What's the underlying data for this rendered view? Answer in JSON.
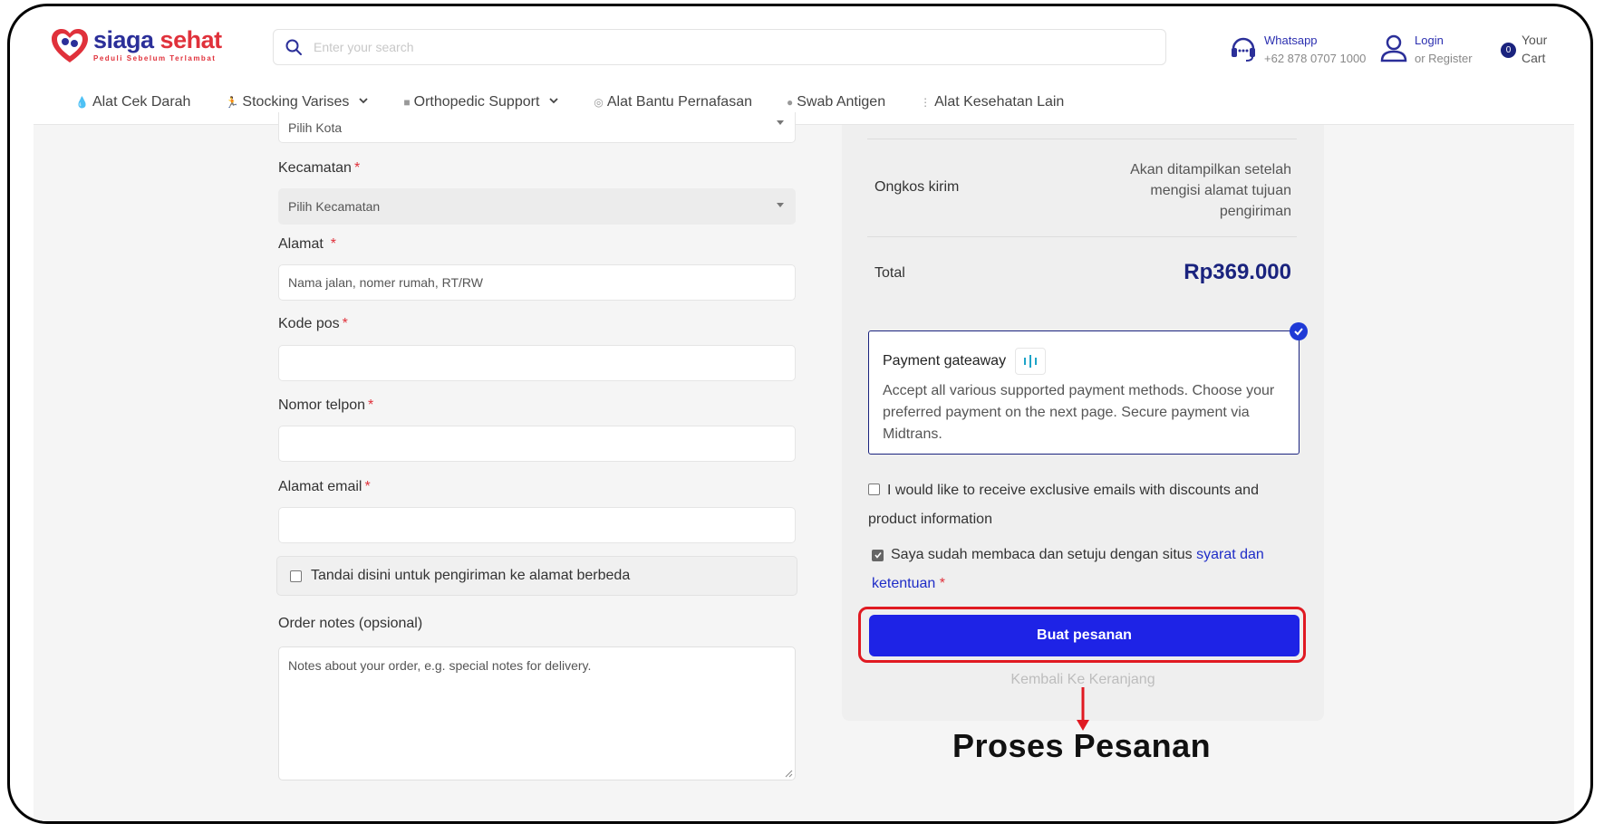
{
  "brand": {
    "name_part1": "siaga ",
    "name_part2": "sehat",
    "tagline": "Peduli Sebelum Terlambat"
  },
  "search": {
    "placeholder": "Enter your search"
  },
  "header": {
    "whatsapp_label": "Whatsapp",
    "whatsapp_number": "+62 878 0707 1000",
    "login_label": "Login",
    "register_label": "or Register",
    "cart_label_1": "Your",
    "cart_label_2": "Cart",
    "cart_count": "0"
  },
  "nav": [
    {
      "label": "Alat Cek Darah",
      "icon": "drop-icon",
      "has_dropdown": false
    },
    {
      "label": "Stocking Varises",
      "icon": "runner-icon",
      "has_dropdown": true
    },
    {
      "label": "Orthopedic Support",
      "icon": "brace-icon",
      "has_dropdown": true
    },
    {
      "label": "Alat Bantu Pernafasan",
      "icon": "mask-icon",
      "has_dropdown": false
    },
    {
      "label": "Swab Antigen",
      "icon": "swab-icon",
      "has_dropdown": false
    },
    {
      "label": "Alat Kesehatan Lain",
      "icon": "more-icon",
      "has_dropdown": false
    }
  ],
  "form": {
    "kota_value": "Pilih Kota",
    "kecamatan_label": "Kecamatan",
    "kecamatan_value": "Pilih Kecamatan",
    "alamat_label": "Alamat",
    "alamat_placeholder": "Nama jalan, nomer rumah, RT/RW",
    "kodepos_label": "Kode pos",
    "telpon_label": "Nomor telpon",
    "email_label": "Alamat email",
    "ship_diff_label": "Tandai disini untuk pengiriman ke alamat berbeda",
    "notes_label": "Order notes (opsional)",
    "notes_placeholder": "Notes about your order, e.g. special notes for delivery.",
    "required_mark": "*"
  },
  "summary": {
    "ongkos_label": "Ongkos kirim",
    "ongkos_value": "Akan ditampilkan setelah mengisi alamat tujuan pengiriman",
    "total_label": "Total",
    "total_value": "Rp369.000",
    "payment_title": "Payment gateaway",
    "payment_desc": "Accept all various supported payment methods. Choose your preferred payment on the next page. Secure payment via Midtrans.",
    "newsletter_label": "I would like to receive exclusive emails with discounts and product information",
    "terms_prefix": "Saya sudah membaca dan setuju dengan situs ",
    "terms_link": "syarat dan ketentuan",
    "place_order": "Buat pesanan",
    "back_to_cart": "Kembali Ke Keranjang"
  },
  "annotation": {
    "text": "Proses Pesanan"
  },
  "colors": {
    "brand_blue": "#2b2f99",
    "brand_red": "#e0313b",
    "button_blue": "#1e23e6",
    "highlight_red": "#e01a22",
    "total_navy": "#1a237e"
  }
}
